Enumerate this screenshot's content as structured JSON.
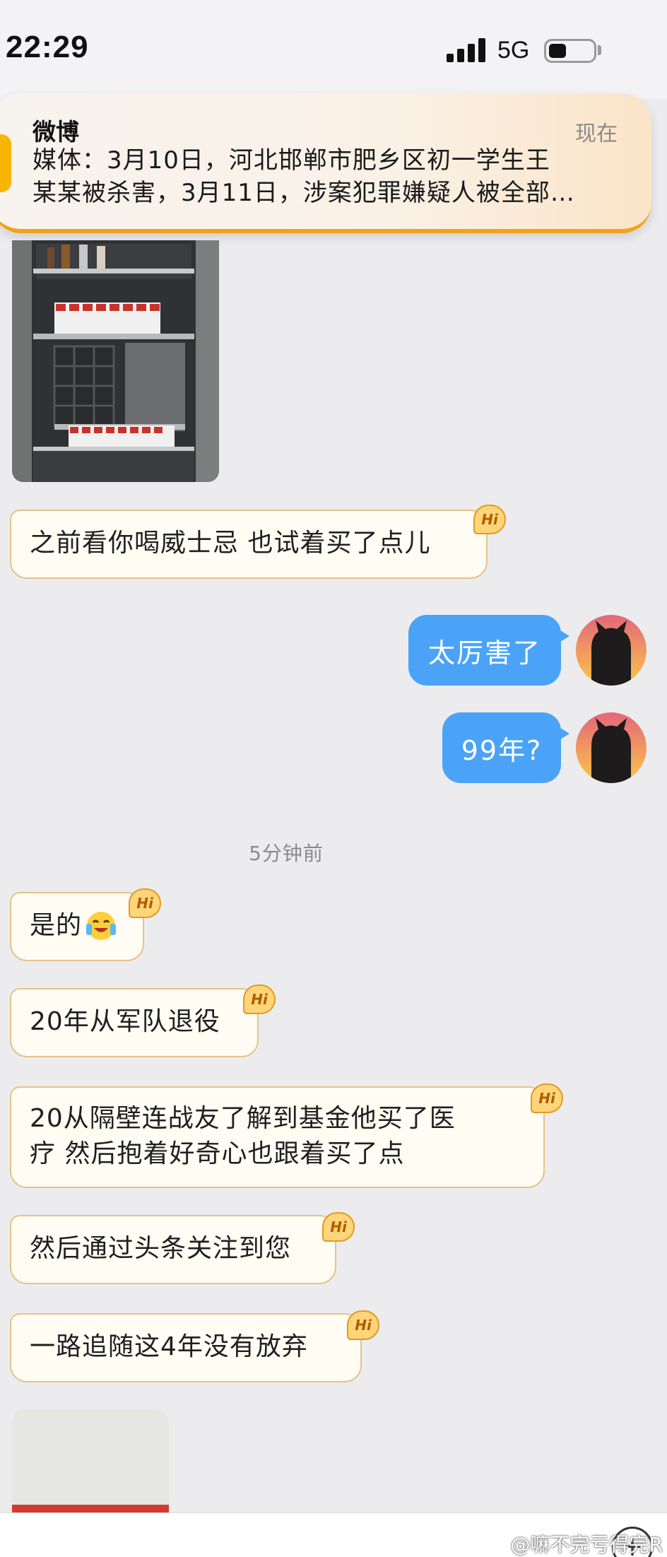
{
  "status_bar": {
    "time": "22:29",
    "network": "5G"
  },
  "notification": {
    "app_name": "微博",
    "time": "现在",
    "line1": "媒体：3月10日，河北邯郸市肥乡区初一学生王",
    "line2": "某某被杀害，3月11日，涉案犯罪嫌疑人被全部…"
  },
  "chat": {
    "hi_badge": "Hi",
    "time_separator": "5分钟前",
    "messages": [
      {
        "side": "in",
        "text": "之前看你喝威士忌 也试着买了点儿"
      },
      {
        "side": "out",
        "text": "太厉害了"
      },
      {
        "side": "out",
        "text": "99年?"
      },
      {
        "side": "in",
        "text": "是的"
      },
      {
        "side": "in",
        "text": "20年从军队退役"
      },
      {
        "side": "in",
        "lines": [
          "20从隔壁连战友了解到基金他买了医",
          "疗 然后抱着好奇心也跟着买了点"
        ]
      },
      {
        "side": "in",
        "text": "然后通过头条关注到您"
      },
      {
        "side": "in",
        "text": "一路追随这4年没有放弃"
      }
    ],
    "emoji": "laughing-crying-emoji"
  },
  "watermark": "@嘛不完亏得完R",
  "icons": {
    "signal": "signal-bars-icon",
    "battery": "battery-icon",
    "add": "plus-icon"
  },
  "colors": {
    "outgoing_bubble": "#4aa3f7",
    "incoming_border": "#e6c28a",
    "hi_badge": "#ffd57a",
    "notification_accent": "#f2a11a"
  }
}
